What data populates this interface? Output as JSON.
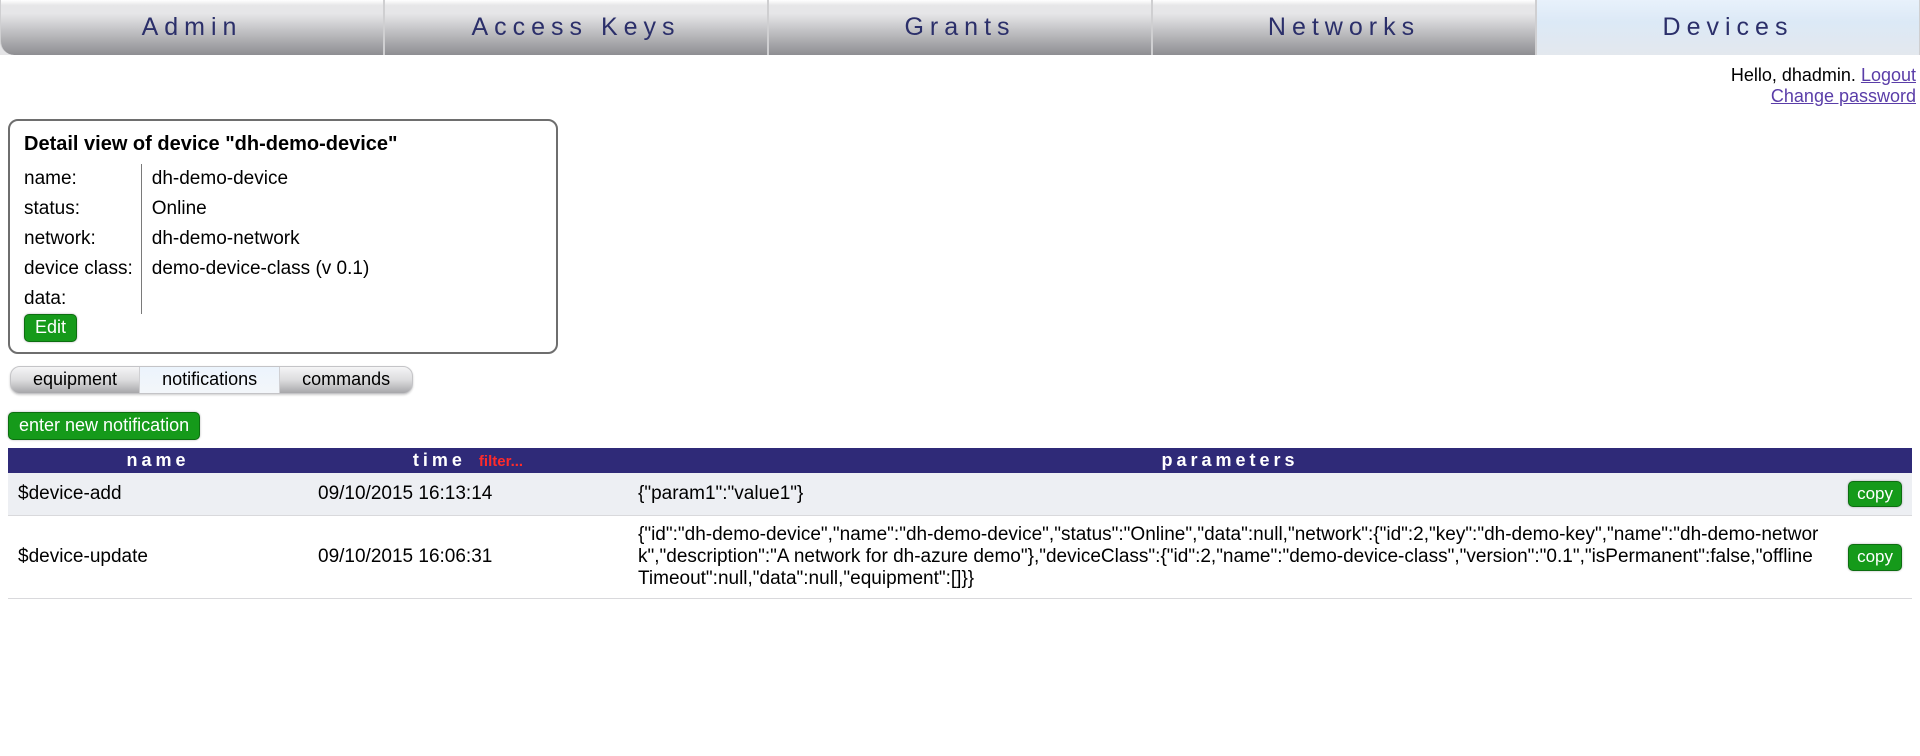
{
  "nav": {
    "tabs": [
      {
        "label": "Admin"
      },
      {
        "label": "Access Keys"
      },
      {
        "label": "Grants"
      },
      {
        "label": "Networks"
      },
      {
        "label": "Devices"
      }
    ],
    "active_index": 4
  },
  "userbar": {
    "hello_prefix": "Hello, ",
    "username": "dhadmin",
    "logout": "Logout",
    "change_password": "Change password"
  },
  "detail": {
    "title": "Detail view of device \"dh-demo-device\"",
    "fields": {
      "name_label": "name:",
      "name_value": "dh-demo-device",
      "status_label": "status:",
      "status_value": "Online",
      "network_label": "network:",
      "network_value": "dh-demo-network",
      "device_class_label": "device class:",
      "device_class_value": "demo-device-class (v 0.1)",
      "data_label": "data:",
      "data_value": ""
    },
    "edit_label": "Edit"
  },
  "subtabs": {
    "items": [
      {
        "label": "equipment"
      },
      {
        "label": "notifications"
      },
      {
        "label": "commands"
      }
    ],
    "active_index": 1
  },
  "actions": {
    "new_notification": "enter new notification"
  },
  "table": {
    "headers": {
      "name": "name",
      "time": "time",
      "time_filter": "filter...",
      "parameters": "parameters"
    },
    "rows": [
      {
        "name": "$device-add",
        "time": "09/10/2015 16:13:14",
        "parameters": "{\"param1\":\"value1\"}",
        "copy_label": "copy"
      },
      {
        "name": "$device-update",
        "time": "09/10/2015 16:06:31",
        "parameters": "{\"id\":\"dh-demo-device\",\"name\":\"dh-demo-device\",\"status\":\"Online\",\"data\":null,\"network\":{\"id\":2,\"key\":\"dh-demo-key\",\"name\":\"dh-demo-network\",\"description\":\"A network for dh-azure demo\"},\"deviceClass\":{\"id\":2,\"name\":\"demo-device-class\",\"version\":\"0.1\",\"isPermanent\":false,\"offlineTimeout\":null,\"data\":null,\"equipment\":[]}}",
        "copy_label": "copy"
      }
    ]
  }
}
